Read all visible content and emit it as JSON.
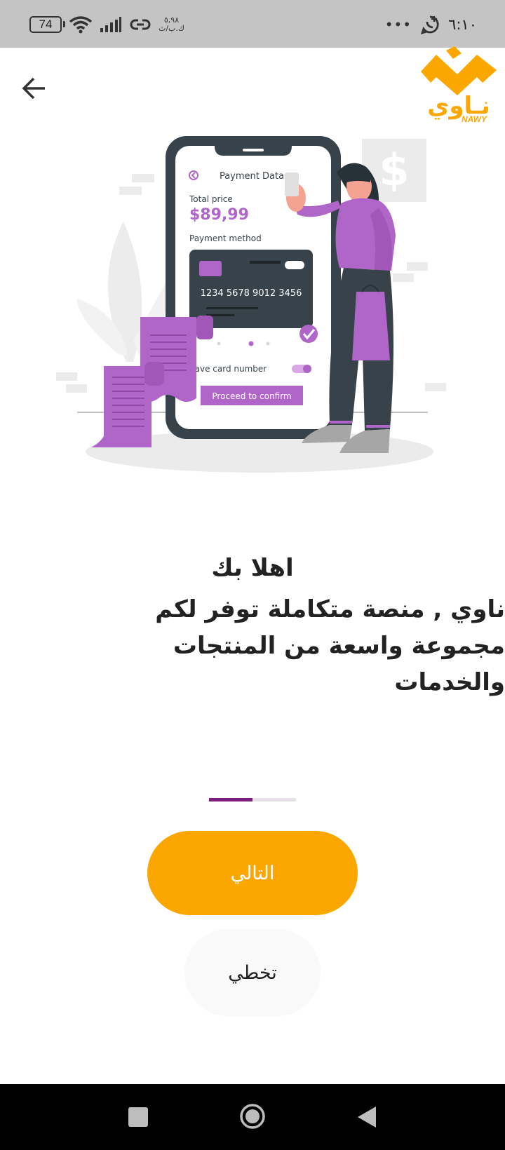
{
  "status_bar": {
    "battery": "74",
    "speed_value": "٥,٩٨",
    "speed_unit": "ك.ب/ث",
    "time": "٦:١٠",
    "more": "•••"
  },
  "icons": {
    "back": "arrow-left-icon",
    "battery": "battery-icon",
    "wifi": "wifi-icon",
    "signal": "signal-icon",
    "link": "hotspot-link-icon",
    "whatsapp": "whatsapp-icon"
  },
  "logo": {
    "arabic": "نـاوي",
    "latin": "NAWY"
  },
  "illustration": {
    "screen_title": "Payment Data",
    "total_price_label": "Total price",
    "total_price": "$89,99",
    "payment_method_label": "Payment method",
    "card_number": "1234 5678 9012 3456",
    "save_card_label": "Save card number",
    "proceed_button": "Proceed to confirm",
    "dollar_sign": "$"
  },
  "onboarding": {
    "title": "اهلا بك",
    "subtitle": "ناوي , منصة متكاملة توفر لكم مجموعة واسعة من المنتجات والخدمات",
    "page_index": 1,
    "page_count": 2
  },
  "buttons": {
    "next": "التالي",
    "skip": "تخطي"
  },
  "colors": {
    "accent": "#fba700",
    "indicator_active": "#7b1c7e",
    "purple": "#b066c8",
    "dark": "#37424a"
  }
}
